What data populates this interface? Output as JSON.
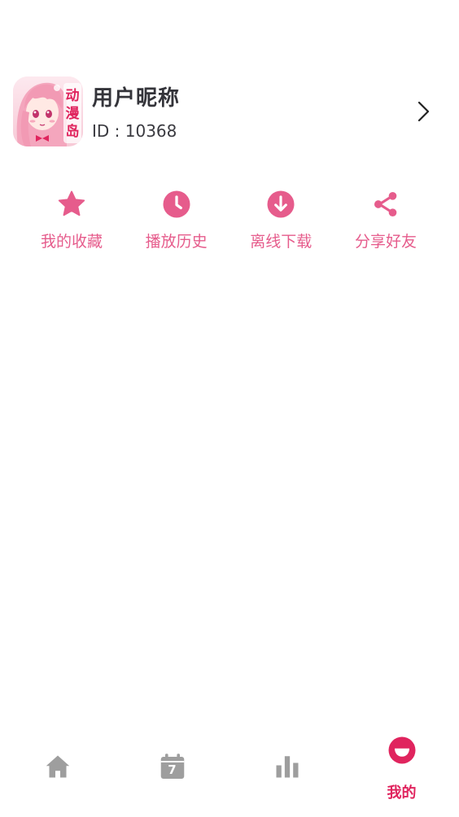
{
  "theme": {
    "accent": "#E65C8C",
    "tab_active": "#E0245E",
    "tab_inactive": "#9E9E9E"
  },
  "profile": {
    "avatar_badge": "动漫岛",
    "nickname": "用户昵称",
    "id_text": "ID : 10368"
  },
  "actions": [
    {
      "label": "我的收藏",
      "icon": "star-icon"
    },
    {
      "label": "播放历史",
      "icon": "clock-icon"
    },
    {
      "label": "离线下载",
      "icon": "download-icon"
    },
    {
      "label": "分享好友",
      "icon": "share-icon"
    }
  ],
  "tabbar": {
    "tabs": [
      {
        "icon": "home-icon",
        "label": "",
        "active": false
      },
      {
        "icon": "calendar-icon",
        "label": "",
        "calendar_day": "7",
        "active": false
      },
      {
        "icon": "bar-chart-icon",
        "label": "",
        "active": false
      },
      {
        "icon": "smile-icon",
        "label": "我的",
        "active": true
      }
    ]
  }
}
